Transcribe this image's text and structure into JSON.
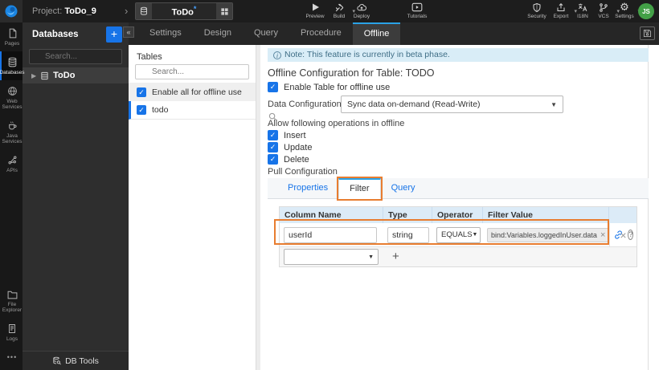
{
  "topbar": {
    "project_label": "Project:",
    "project_name": "ToDo_9",
    "artifact_tab": {
      "name": "ToDo",
      "modified_indicator": "*"
    },
    "actions": [
      {
        "label": "Preview",
        "icon": "play-icon"
      },
      {
        "label": "Build",
        "icon": "build-tools-icon"
      },
      {
        "label": "Deploy",
        "icon": "deploy-cloud-icon"
      },
      {
        "label": "Tutorials",
        "icon": "video-icon"
      },
      {
        "label": "Security",
        "icon": "shield-icon"
      },
      {
        "label": "Export",
        "icon": "export-icon"
      },
      {
        "label": "I18N",
        "icon": "translate-icon"
      },
      {
        "label": "VCS",
        "icon": "branch-icon"
      },
      {
        "label": "Settings",
        "icon": "gear-icon"
      }
    ],
    "avatar": "JS"
  },
  "rail": {
    "items": [
      {
        "label": "Pages",
        "icon": "page-icon"
      },
      {
        "label": "Databases",
        "icon": "database-icon"
      },
      {
        "label": "Web Services",
        "icon": "globe-icon"
      },
      {
        "label": "Java Services",
        "icon": "java-cup-icon"
      },
      {
        "label": "APIs",
        "icon": "api-nodes-icon"
      }
    ],
    "bottom_items": [
      {
        "label": "File Explorer",
        "icon": "folder-icon"
      },
      {
        "label": "Logs",
        "icon": "log-file-icon"
      },
      {
        "label": "•••",
        "icon": "ellipsis-icon"
      }
    ]
  },
  "databases_panel": {
    "title": "Databases",
    "add_button": "+",
    "collapse_button": "«",
    "search_placeholder": "Search...",
    "items": [
      {
        "label": "ToDo"
      }
    ],
    "footer_label": "DB Tools"
  },
  "top_tabs": {
    "items": [
      "Settings",
      "Design",
      "Query",
      "Procedure",
      "Offline"
    ],
    "active": "Offline"
  },
  "tables_panel": {
    "title": "Tables",
    "search_placeholder": "Search...",
    "enable_all_label": "Enable all for offline use",
    "tables": [
      {
        "label": "todo",
        "checked": true,
        "selected": true
      }
    ]
  },
  "main": {
    "note_text": "Note: This feature is currently in beta phase.",
    "title": "Offline Configuration for Table: TODO",
    "enable_table_label": "Enable Table for offline use",
    "data_configuration": {
      "label": "Data Configuration",
      "value": "Sync data on-demand (Read-Write)"
    },
    "operations": {
      "label": "Allow following operations in offline",
      "items": [
        "Insert",
        "Update",
        "Delete"
      ]
    },
    "pull_configuration": {
      "label": "Pull Configuration",
      "tabs": [
        "Properties",
        "Filter",
        "Query"
      ],
      "active_tab": "Filter"
    },
    "filter_table": {
      "columns": [
        "Column Name",
        "Type",
        "Operator",
        "Filter Value"
      ],
      "rows": [
        {
          "column_name": "userId",
          "type": "string",
          "operator": "EQUALS",
          "filter_value_chip": "bind:Variables.loggedInUser.data"
        }
      ],
      "add_button": "+"
    }
  },
  "colors": {
    "accent_blue": "#1774e8",
    "active_tab_blue": "#2aa2e6",
    "annotation_orange": "#e87d30",
    "note_bg": "#d9edf7",
    "table_header_bg": "#dcebf7",
    "avatar_green": "#43a047"
  }
}
